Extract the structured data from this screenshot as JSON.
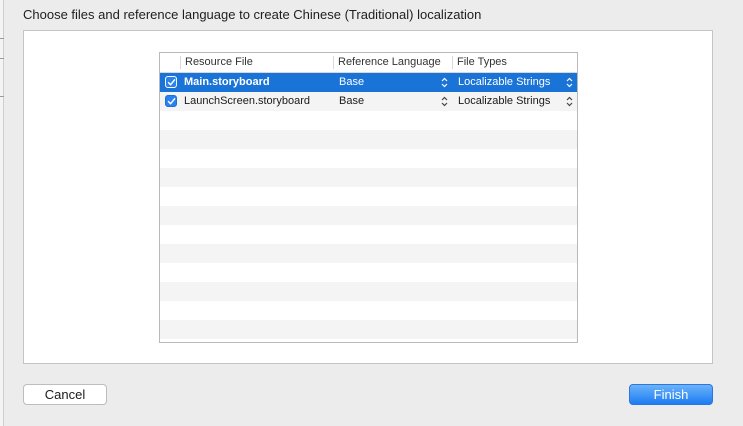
{
  "dialog": {
    "title": "Choose files and reference language to create Chinese (Traditional) localization"
  },
  "table": {
    "columns": [
      {
        "label": ""
      },
      {
        "label": "Resource File"
      },
      {
        "label": "Reference Language"
      },
      {
        "label": "File Types"
      }
    ],
    "rows": [
      {
        "checked": true,
        "selected": true,
        "file": "Main.storyboard",
        "language": "Base",
        "type": "Localizable Strings"
      },
      {
        "checked": true,
        "selected": false,
        "file": "LaunchScreen.storyboard",
        "language": "Base",
        "type": "Localizable Strings"
      }
    ]
  },
  "buttons": {
    "cancel": "Cancel",
    "finish": "Finish"
  },
  "colors": {
    "selection": "#1a73d7",
    "accent": "#1c7cf3"
  }
}
